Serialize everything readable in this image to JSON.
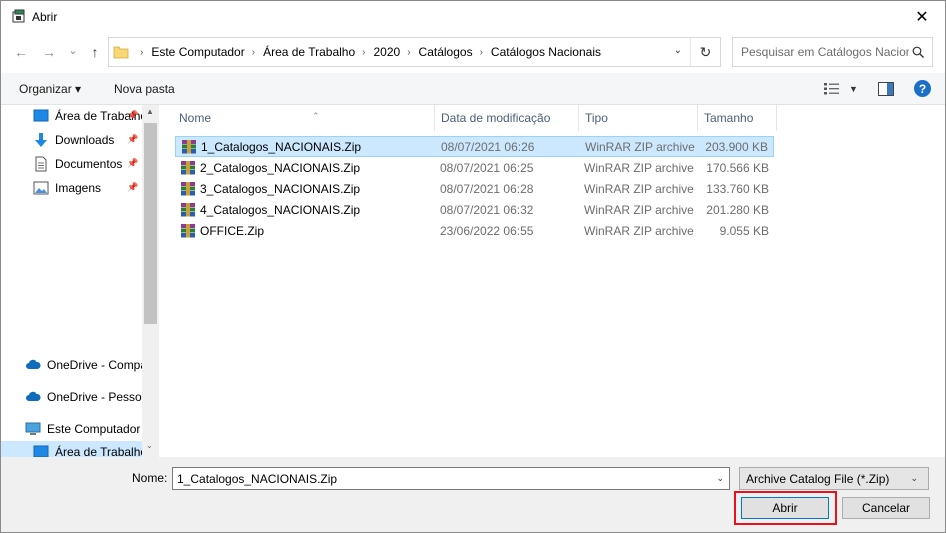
{
  "window": {
    "title": "Abrir",
    "close_glyph": "✕"
  },
  "nav": {
    "back_glyph": "←",
    "forward_glyph": "→",
    "recent_glyph": "⌄",
    "up_glyph": "↑"
  },
  "address": {
    "crumbs": [
      "Este Computador",
      "Área de Trabalho",
      "2020",
      "Catálogos",
      "Catálogos Nacionais"
    ],
    "separator": "›",
    "dropdown_glyph": "⌄",
    "refresh_glyph": "↻"
  },
  "search": {
    "placeholder": "Pesquisar em Catálogos Nacionais"
  },
  "toolbar": {
    "organize_label": "Organizar ▾",
    "new_folder_label": "Nova pasta",
    "view_dropdown_glyph": "▼",
    "help_label": "?"
  },
  "sidebar": {
    "items": [
      {
        "label": "Área de Trabalho",
        "icon": "desktop-icon",
        "pinned": true
      },
      {
        "label": "Downloads",
        "icon": "download-icon",
        "pinned": true
      },
      {
        "label": "Documentos",
        "icon": "document-icon",
        "pinned": true
      },
      {
        "label": "Imagens",
        "icon": "image-icon",
        "pinned": true
      },
      {
        "label": "OneDrive - Compartilhado",
        "icon": "cloud-icon",
        "pinned": false
      },
      {
        "label": "OneDrive - Pessoal",
        "icon": "cloud-icon",
        "pinned": false
      },
      {
        "label": "Este Computador",
        "icon": "computer-icon",
        "pinned": false
      },
      {
        "label": "Área de Trabalho",
        "icon": "desktop-icon",
        "pinned": false
      }
    ],
    "pin_glyph": "📌",
    "scroll_up_glyph": "▲",
    "scroll_down_glyph": "⌄"
  },
  "columns": {
    "name": "Nome",
    "date": "Data de modificação",
    "type": "Tipo",
    "size": "Tamanho",
    "sort_glyph": "⌃"
  },
  "files": [
    {
      "name": "1_Catalogos_NACIONAIS.Zip",
      "date": "08/07/2021 06:26",
      "type": "WinRAR ZIP archive",
      "size": "203.900 KB"
    },
    {
      "name": "2_Catalogos_NACIONAIS.Zip",
      "date": "08/07/2021 06:25",
      "type": "WinRAR ZIP archive",
      "size": "170.566 KB"
    },
    {
      "name": "3_Catalogos_NACIONAIS.Zip",
      "date": "08/07/2021 06:28",
      "type": "WinRAR ZIP archive",
      "size": "133.760 KB"
    },
    {
      "name": "4_Catalogos_NACIONAIS.Zip",
      "date": "08/07/2021 06:32",
      "type": "WinRAR ZIP archive",
      "size": "201.280 KB"
    },
    {
      "name": "OFFICE.Zip",
      "date": "23/06/2022 06:55",
      "type": "WinRAR ZIP archive",
      "size": "9.055 KB"
    }
  ],
  "footer": {
    "name_label": "Nome:",
    "name_value": "1_Catalogos_NACIONAIS.Zip",
    "name_dropdown_glyph": "⌄",
    "filter_value": "Archive Catalog File (*.Zip)",
    "filter_dropdown_glyph": "⌄",
    "open_label": "Abrir",
    "cancel_label": "Cancelar"
  },
  "colors": {
    "selection": "#cce8ff",
    "accent_blue": "#0078d7",
    "highlight_red": "#e8121b"
  }
}
